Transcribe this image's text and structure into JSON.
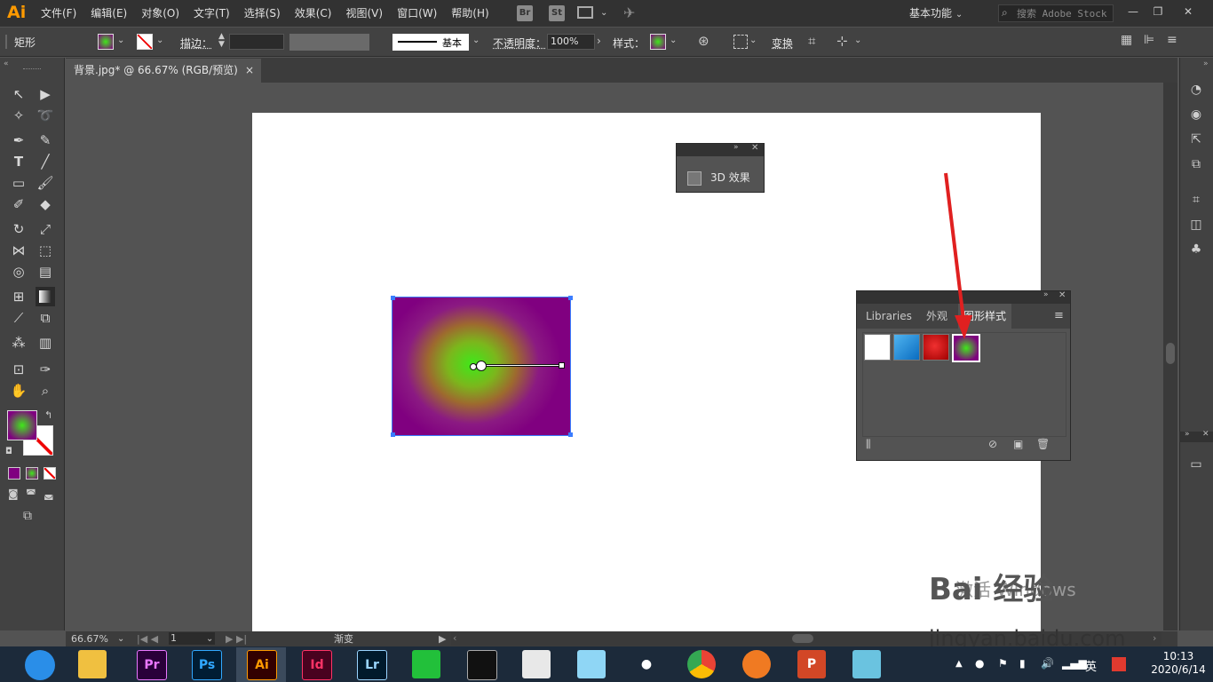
{
  "app": {
    "logo": "Ai"
  },
  "menu": [
    "文件(F)",
    "编辑(E)",
    "对象(O)",
    "文字(T)",
    "选择(S)",
    "效果(C)",
    "视图(V)",
    "窗口(W)",
    "帮助(H)"
  ],
  "bridge_icons": [
    "Br",
    "St"
  ],
  "workspace": "基本功能",
  "search": {
    "placeholder": "搜索 Adobe Stock"
  },
  "control": {
    "object_type": "矩形",
    "stroke_label": "描边：",
    "stroke_style": "基本",
    "opacity_label": "不透明度：",
    "opacity_value": "100%",
    "style_label": "样式：",
    "transform_label": "变换"
  },
  "document": {
    "tab_title": "背景.jpg* @ 66.67% (RGB/预览)",
    "close": "×"
  },
  "panel_3d": {
    "item": "3D 效果"
  },
  "graphic_styles": {
    "tabs": [
      "Libraries",
      "外观",
      "图形样式"
    ],
    "active_tab": 2
  },
  "status": {
    "zoom": "66.67%",
    "page": "1",
    "tool_name": "渐变"
  },
  "taskbar": {
    "apps": [
      "Pr",
      "Ps",
      "Ai",
      "Id",
      "Lr"
    ],
    "tray_lang": "英",
    "time": "10:13",
    "date": "2020/6/14"
  },
  "watermark": {
    "brand": "Bai 经验",
    "url": "jingyan.baidu.com",
    "activate": "激活 Windows"
  },
  "colors": {
    "accent": "#3b7dff",
    "gradient_center": "#3fe81a",
    "gradient_edge": "#800080",
    "arrow": "#e02020"
  }
}
